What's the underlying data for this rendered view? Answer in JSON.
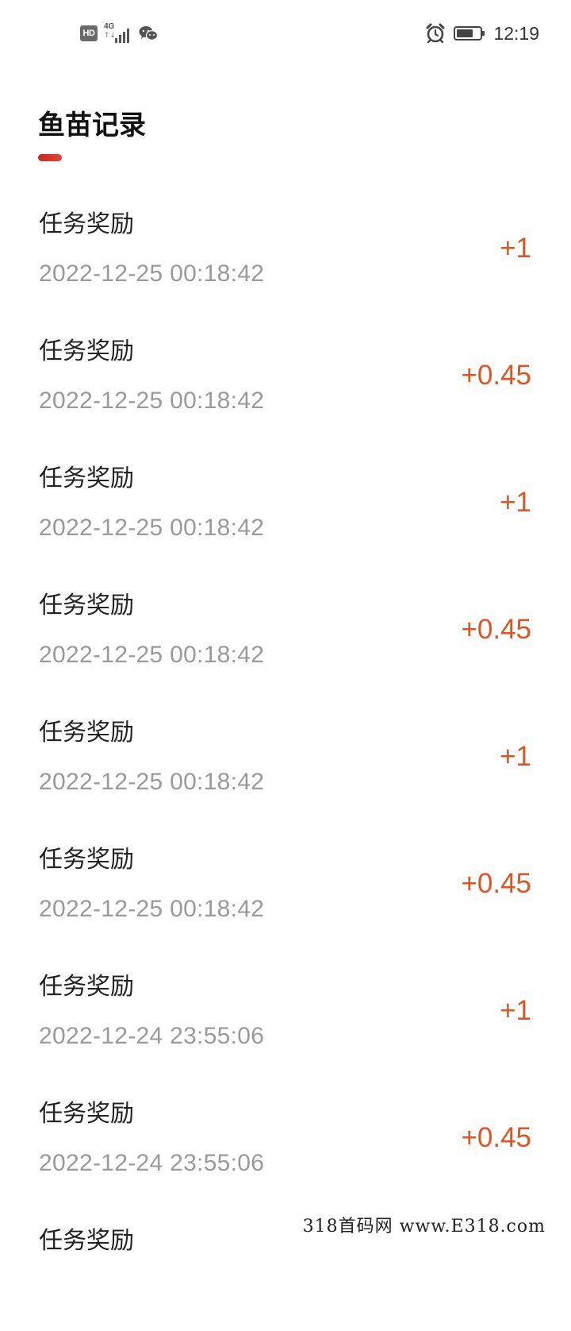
{
  "status_bar": {
    "hd_label": "HD",
    "network_type": "4G",
    "signal_arrows": "↑↓",
    "signal_level": 4,
    "chat_icon": "wechat-icon",
    "alarm_icon": "alarm-icon",
    "battery_level": 0.7,
    "time": "12:19"
  },
  "header": {
    "title": "鱼苗记录"
  },
  "colors": {
    "accent": "#d4301f",
    "amount": "#e2531f",
    "time_text": "#9a9a9a"
  },
  "records": [
    {
      "title": "任务奖励",
      "time": "2022-12-25 00:18:42",
      "amount": "+1"
    },
    {
      "title": "任务奖励",
      "time": "2022-12-25 00:18:42",
      "amount": "+0.45"
    },
    {
      "title": "任务奖励",
      "time": "2022-12-25 00:18:42",
      "amount": "+1"
    },
    {
      "title": "任务奖励",
      "time": "2022-12-25 00:18:42",
      "amount": "+0.45"
    },
    {
      "title": "任务奖励",
      "time": "2022-12-25 00:18:42",
      "amount": "+1"
    },
    {
      "title": "任务奖励",
      "time": "2022-12-25 00:18:42",
      "amount": "+0.45"
    },
    {
      "title": "任务奖励",
      "time": "2022-12-24 23:55:06",
      "amount": "+1"
    },
    {
      "title": "任务奖励",
      "time": "2022-12-24 23:55:06",
      "amount": "+0.45"
    },
    {
      "title": "任务奖励",
      "time": "",
      "amount": ""
    }
  ],
  "watermark": "318首码网 www.E318.com"
}
